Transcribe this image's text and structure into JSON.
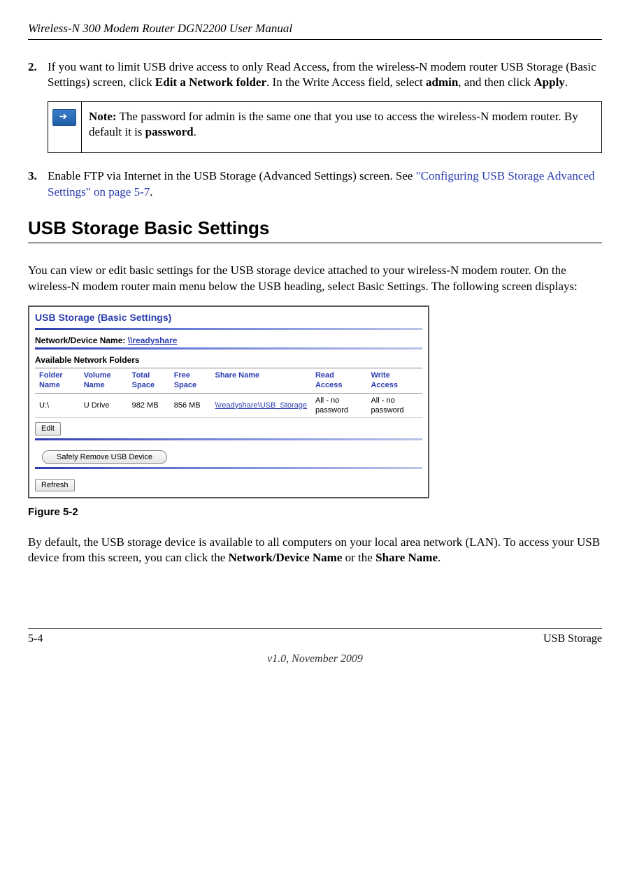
{
  "doc_header": "Wireless-N 300 Modem Router DGN2200 User Manual",
  "steps": [
    {
      "num": "2.",
      "before_bold1": "If you want to limit USB drive access to only Read Access, from the wireless-N modem router USB Storage (Basic Settings) screen, click ",
      "bold1": "Edit a Network folder",
      "mid1": ". In the Write Access field, select ",
      "bold2": "admin",
      "mid2": ", and then click ",
      "bold3": "Apply",
      "after": "."
    },
    {
      "num": "3.",
      "before_link": "Enable FTP via Internet in the USB Storage (Advanced Settings) screen. See ",
      "link": "\"Configuring USB Storage Advanced Settings\" on page 5-7",
      "after_link": "."
    }
  ],
  "note": {
    "label": "Note:",
    "text_before": " The password for admin is the same one that you use to access the wireless-N modem router. By default it is ",
    "bold": "password",
    "after": "."
  },
  "section_heading": "USB Storage Basic Settings",
  "intro_para": "You can view or edit basic settings for the USB storage device attached to your wireless-N modem router. On the wireless-N modem router main menu below the USB heading, select Basic Settings. The following screen displays:",
  "figure": {
    "title": "USB Storage (Basic Settings)",
    "netdev_label": "Network/Device Name: ",
    "netdev_link": "\\\\readyshare",
    "avail_label": "Available Network Folders",
    "headers": {
      "c1": "Folder Name",
      "c2": "Volume Name",
      "c3": "Total Space",
      "c4": "Free Space",
      "c5": "Share Name",
      "c6": "Read Access",
      "c7": "Write Access"
    },
    "row": {
      "c1": "U:\\",
      "c2": "U Drive",
      "c3": "982 MB",
      "c4": "856 MB",
      "c5": "\\\\readyshare\\USB_Storage",
      "c6": "All - no password",
      "c7": "All - no password"
    },
    "edit_btn": "Edit",
    "remove_btn": "Safely Remove USB Device",
    "refresh_btn": "Refresh"
  },
  "figure_caption": "Figure 5-2",
  "closing_para": {
    "before_b1": "By default, the USB storage device is available to all computers on your local area network (LAN). To access your USB device from this screen, you can click the ",
    "b1": "Network/Device Name",
    "mid": " or the ",
    "b2": "Share Name",
    "after": "."
  },
  "footer": {
    "left": "5-4",
    "right": "USB Storage",
    "center": "v1.0, November 2009"
  }
}
